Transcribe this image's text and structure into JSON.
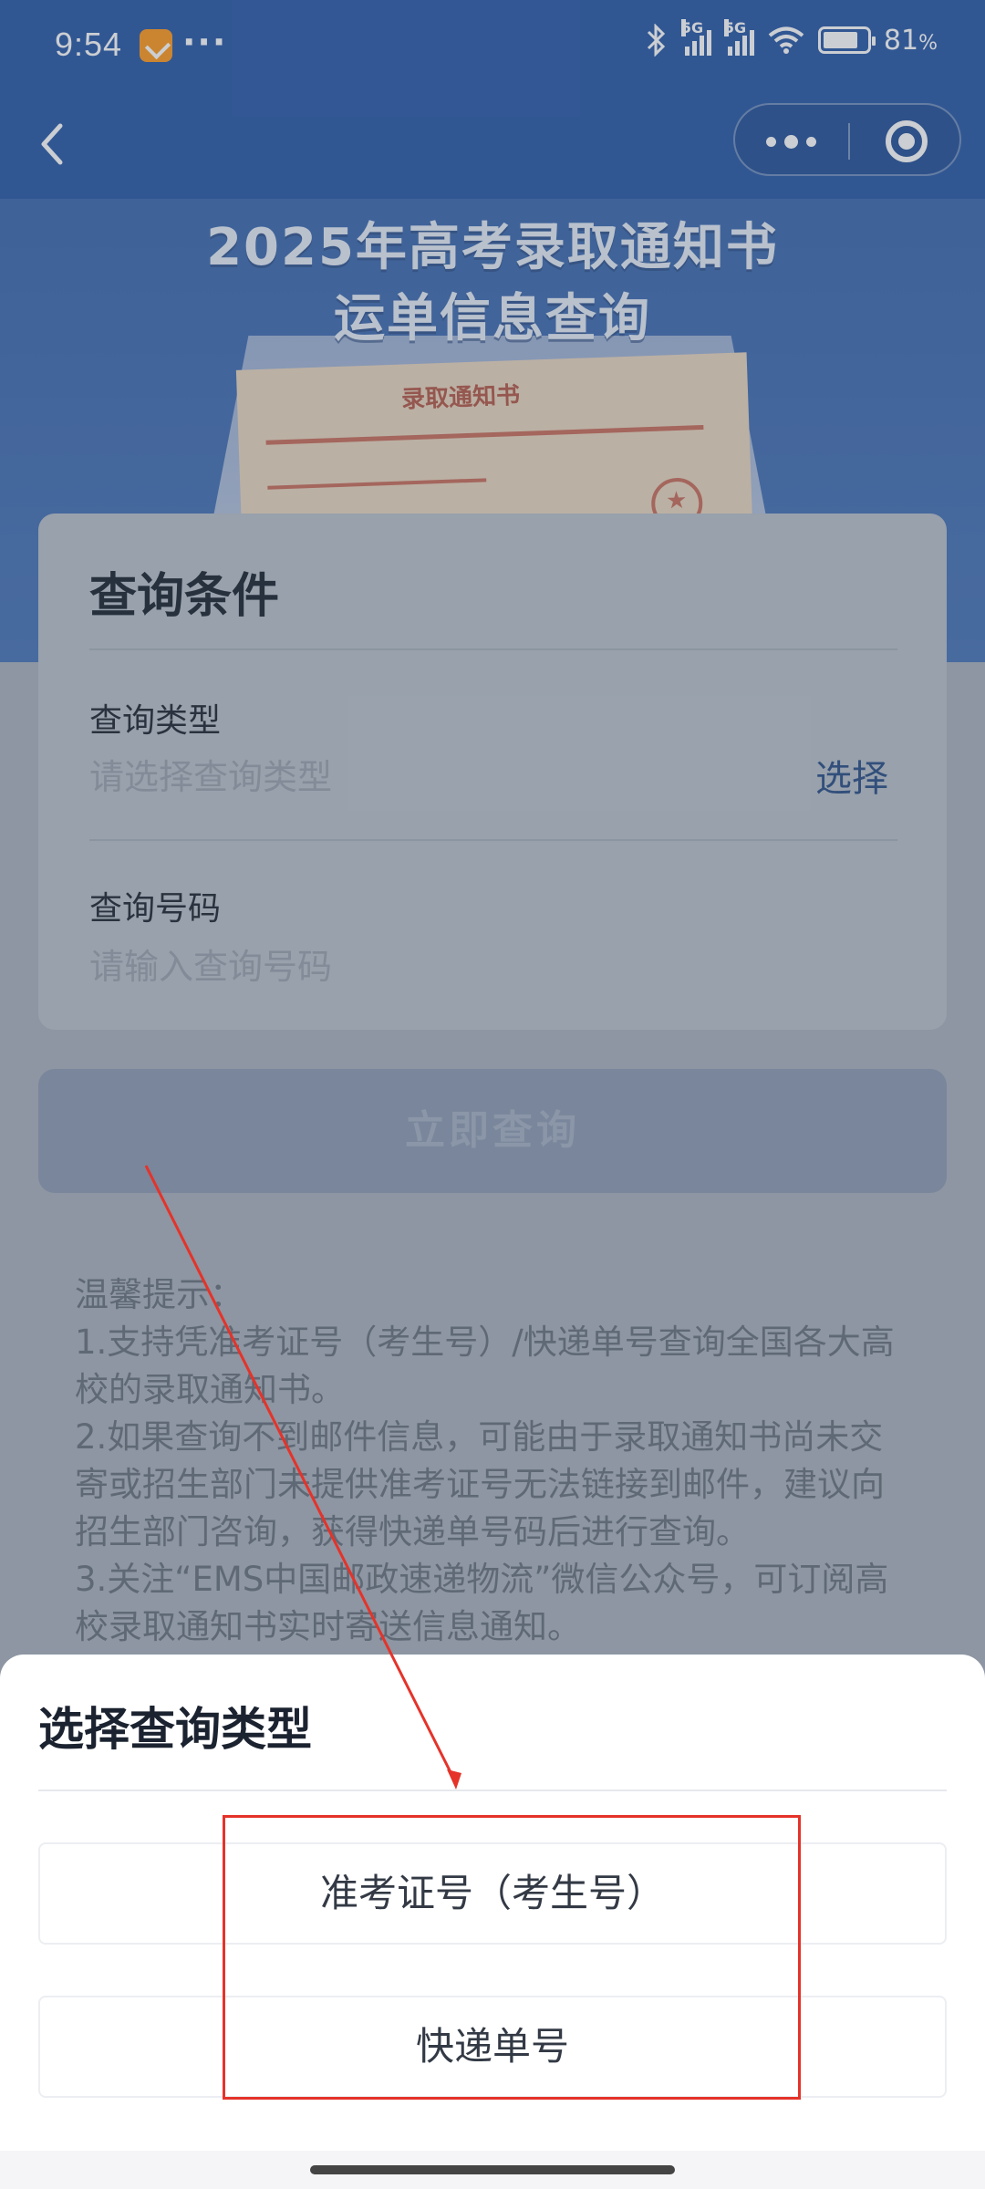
{
  "status_bar": {
    "time": "9:54",
    "more_dots": "···",
    "battery": "81",
    "battery_unit": "%",
    "network_1": "5G",
    "network_2": "5G"
  },
  "nav": {
    "back_icon": "chevron-left-icon",
    "more_icon": "more-dots-icon",
    "close_icon": "target-circle-icon"
  },
  "hero": {
    "title_line1": "2025年高考录取通知书",
    "title_line2": "运单信息查询",
    "paper_title": "录取通知书"
  },
  "query_card": {
    "heading": "查询条件",
    "type_label": "查询类型",
    "type_placeholder": "请选择查询类型",
    "type_action": "选择",
    "number_label": "查询号码",
    "number_placeholder": "请输入查询号码"
  },
  "submit_label": "立即查询",
  "tips": {
    "title": "温馨提示：",
    "items": [
      "1.支持凭准考证号（考生号）/快递单号查询全国各大高校的录取通知书。",
      "2.如果查询不到邮件信息，可能由于录取通知书尚未交寄或招生部门未提供准考证号无法链接到邮件，建议向招生部门咨询，获得快递单号码后进行查询。",
      "3.关注“EMS中国邮政速递物流”微信公众号，可订阅高校录取通知书实时寄送信息通知。"
    ]
  },
  "sheet": {
    "title": "选择查询类型",
    "options": [
      {
        "label": "准考证号（考生号）"
      },
      {
        "label": "快递单号"
      }
    ]
  },
  "colors": {
    "brand_blue": "#2a5aa8",
    "annotation_red": "#e5332a"
  }
}
